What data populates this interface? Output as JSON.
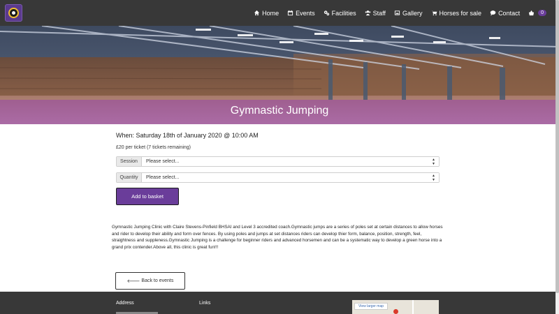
{
  "nav": {
    "items": [
      {
        "label": "Home",
        "icon": "home-icon"
      },
      {
        "label": "Events",
        "icon": "calendar-icon"
      },
      {
        "label": "Facilities",
        "icon": "cogs-icon"
      },
      {
        "label": "Staff",
        "icon": "users-icon"
      },
      {
        "label": "Gallery",
        "icon": "image-icon"
      },
      {
        "label": "Horses for sale",
        "icon": "cart-icon"
      },
      {
        "label": "Contact",
        "icon": "comment-icon"
      }
    ],
    "basket_count": "0"
  },
  "hero": {
    "title": "Gymnastic Jumping"
  },
  "event": {
    "when": "When: Saturday 18th of January 2020 @ 10:00 AM",
    "price": "£20 per ticket (7 tickets remaining)",
    "session_label": "Session",
    "session_value": "Please select...",
    "quantity_label": "Quantity",
    "quantity_value": "Please select...",
    "add_label": "Add to basket",
    "description": "Gymnastic Jumping Clinic with Claire Stevens-Pinfield BHSAI and Level 3 accredited coach.Gymnastic jumps are a series of poles set at certain distances to allow horses and rider to develop their ability and form over fences. By using poles and jumps at set distances riders can develop thier form, balance, position, strength, feel, straightness and suppleness.Gymnastic Jumping is a challenge for beginner riders and advanced horsemen and can be a systematic way to develop a green horse into a grand prix contender.Above all, this clinic is great fun!!!",
    "back_label": "Back to events"
  },
  "footer": {
    "address_heading": "Address",
    "links_heading": "Links",
    "map_button": "View larger map"
  },
  "colors": {
    "navbar": "#383838",
    "accent": "#6a3d9a",
    "hero_band": "#9646aa"
  }
}
